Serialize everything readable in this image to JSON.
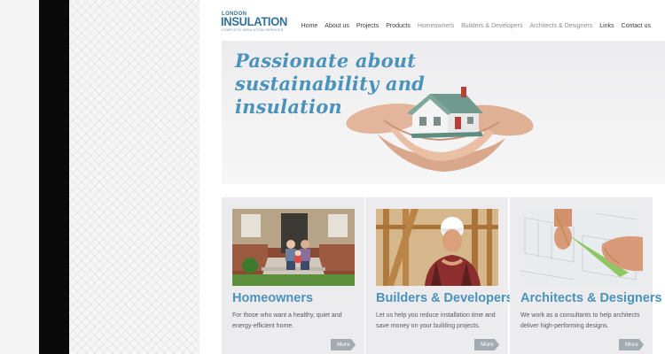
{
  "logo": {
    "line1": "LONDON",
    "line2": "INSULATION",
    "tagline": "COMPLETE INSULATION SERVICES"
  },
  "nav": {
    "items": [
      {
        "label": "Home"
      },
      {
        "label": "About us"
      },
      {
        "label": "Projects"
      },
      {
        "label": "Products"
      },
      {
        "label": "Homeowners"
      },
      {
        "label": "Builders & Developers"
      },
      {
        "label": "Architects & Designers"
      },
      {
        "label": "Links"
      },
      {
        "label": "Contact us"
      }
    ]
  },
  "hero": {
    "lines": [
      "Passionate about",
      "sustainability and",
      "insulation"
    ]
  },
  "cards": [
    {
      "title": "Homeowners",
      "text": "For those who want a healthy, quiet and energy-efficient home.",
      "more": "More"
    },
    {
      "title": "Builders & Developers",
      "text": "Let us help you reduce installation time and save money on your building projects.",
      "more": "More"
    },
    {
      "title": "Architects & Designers",
      "text": "We work as a consultants to help architects deliver high-performing designs.",
      "more": "More"
    }
  ],
  "colors": {
    "accent": "#4a93bb",
    "logo": "#2f6f98",
    "button": "#a3abb2"
  }
}
